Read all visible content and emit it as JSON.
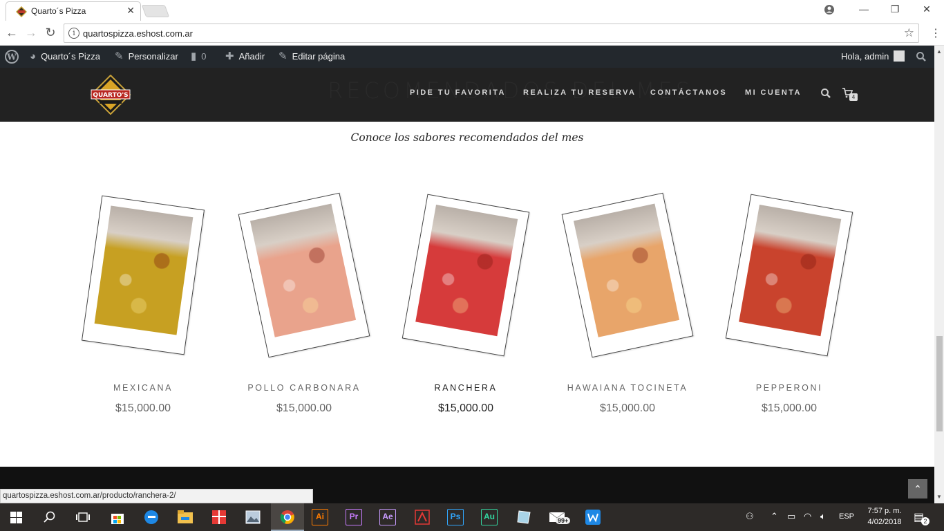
{
  "browser": {
    "tab_title": "Quarto´s Pizza",
    "url": "quartospizza.eshost.com.ar",
    "status_url": "quartospizza.eshost.com.ar/producto/ranchera-2/"
  },
  "admin_bar": {
    "site": "Quarto´s Pizza",
    "customize": "Personalizar",
    "comments": "0",
    "add": "Añadir",
    "edit": "Editar página",
    "greeting": "Hola, admin"
  },
  "header": {
    "section_title": "RECOMENDADOS DEL MES",
    "logo_text": "QUARTO'S",
    "menu": [
      "PIDE TU FAVORITA",
      "REALIZA TU RESERVA",
      "CONTÁCTANOS",
      "MI CUENTA"
    ],
    "cart_count": "4"
  },
  "section": {
    "subtitle": "Conoce los sabores recomendados del mes"
  },
  "products": [
    {
      "name": "MEXICANA",
      "price": "$15,000.00",
      "tone": "#c7a022"
    },
    {
      "name": "POLLO CARBONARA",
      "price": "$15,000.00",
      "tone": "#e9a38c"
    },
    {
      "name": "RANCHERA",
      "price": "$15,000.00",
      "tone": "#d63b3b"
    },
    {
      "name": "HAWAIANA TOCINETA",
      "price": "$15,000.00",
      "tone": "#e8a56a"
    },
    {
      "name": "PEPPERONI",
      "price": "$15,000.00",
      "tone": "#c9432d"
    }
  ],
  "taskbar": {
    "apps": [
      {
        "label": "Ai",
        "color": "#ff7c00"
      },
      {
        "label": "Pr",
        "color": "#c97dff"
      },
      {
        "label": "Ae",
        "color": "#c79bff"
      },
      {
        "label": "Ps",
        "color": "#31a8ff"
      },
      {
        "label": "Au",
        "color": "#33d6a0"
      }
    ],
    "mail_badge": "99+",
    "lang": "ESP",
    "time": "7:57 p. m.",
    "date": "4/02/2018",
    "notifications": "2"
  },
  "colors": {
    "accent_dark": "#222222",
    "admin_bar": "#23282d"
  }
}
